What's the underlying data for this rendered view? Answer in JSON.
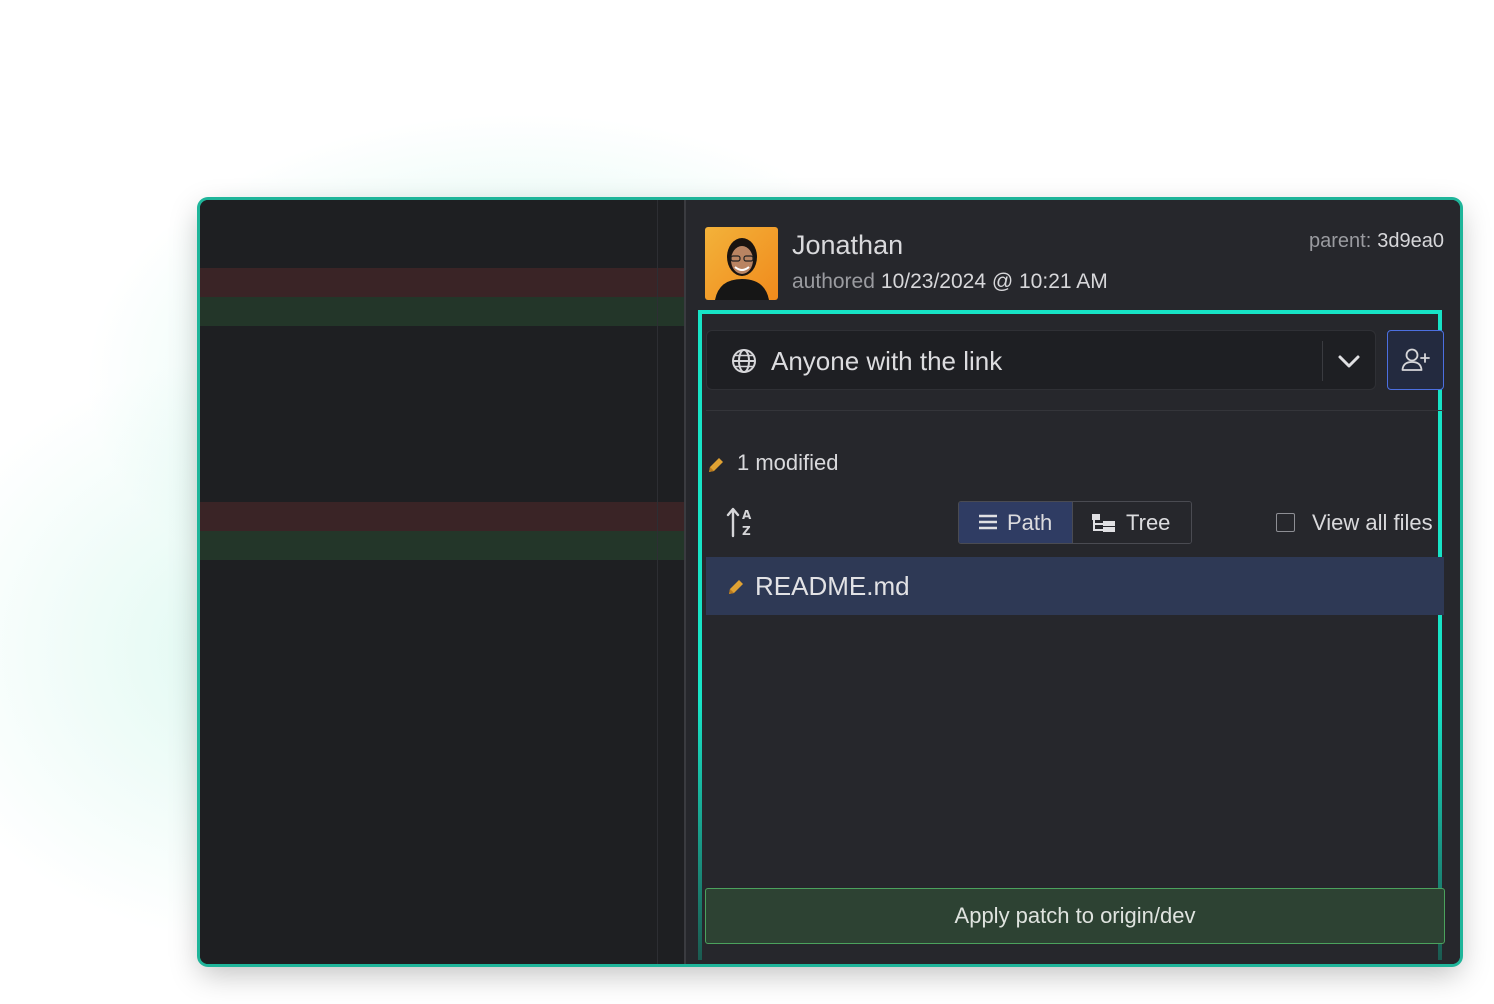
{
  "commit": {
    "author": "Jonathan",
    "authored_label": "authored",
    "date": "10/23/2024 @ 10:21 AM",
    "parent_label": "parent:",
    "parent_hash": "3d9ea0"
  },
  "share": {
    "selected": "Anyone with the link",
    "icon": "globe-icon",
    "add_user_icon": "user-plus-icon"
  },
  "changes": {
    "summary": "1 modified",
    "view_modes": [
      "Path",
      "Tree"
    ],
    "active_view": "Path",
    "view_all_label": "View all files",
    "view_all_checked": false,
    "files": [
      {
        "name": "README.md",
        "status": "modified"
      }
    ]
  },
  "actions": {
    "apply_label": "Apply patch to origin/dev"
  },
  "colors": {
    "accent_highlight": "#17e3c6",
    "apply_button_border": "#4ba25d",
    "modified_icon": "#e0a233",
    "selected_row": "#2e3955"
  }
}
